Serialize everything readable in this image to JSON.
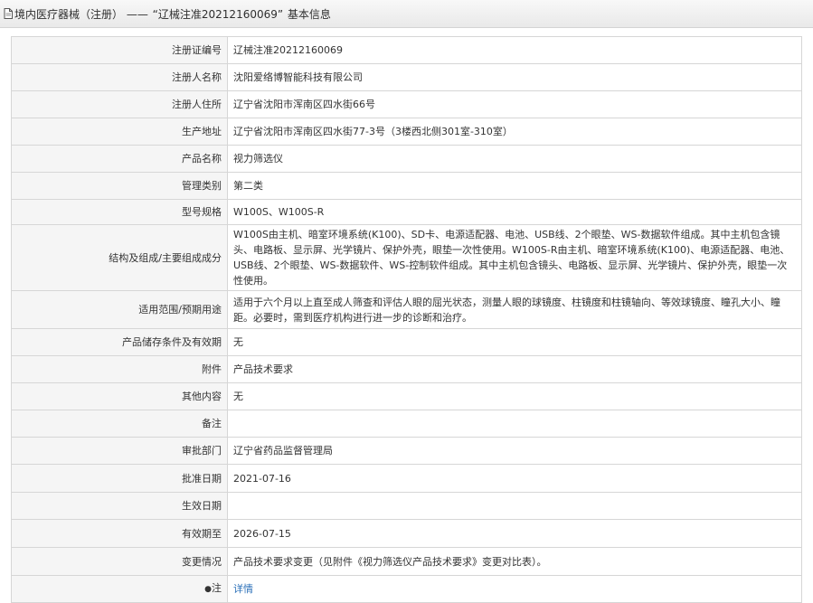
{
  "header": {
    "prefix": "境内医疗器械（注册）",
    "dash": "——",
    "reg_quote": "“辽械注准20212160069”",
    "suffix": "基本信息"
  },
  "rows": [
    {
      "label": "注册证编号",
      "value": "辽械注准20212160069"
    },
    {
      "label": "注册人名称",
      "value": "沈阳爱络博智能科技有限公司"
    },
    {
      "label": "注册人住所",
      "value": "辽宁省沈阳市浑南区四水街66号"
    },
    {
      "label": "生产地址",
      "value": "辽宁省沈阳市浑南区四水街77-3号（3楼西北侧301室-310室）"
    },
    {
      "label": "产品名称",
      "value": "视力筛选仪"
    },
    {
      "label": "管理类别",
      "value": "第二类"
    },
    {
      "label": "型号规格",
      "value": "W100S、W100S-R"
    },
    {
      "label": "结构及组成/主要组成成分",
      "value": "W100S由主机、暗室环境系统(K100)、SD卡、电源适配器、电池、USB线、2个眼垫、WS-数据软件组成。其中主机包含镜头、电路板、显示屏、光学镜片、保护外壳，眼垫一次性使用。W100S-R由主机、暗室环境系统(K100)、电源适配器、电池、USB线、2个眼垫、WS-数据软件、WS-控制软件组成。其中主机包含镜头、电路板、显示屏、光学镜片、保护外壳，眼垫一次性使用。"
    },
    {
      "label": "适用范围/预期用途",
      "value": "适用于六个月以上直至成人筛查和评估人眼的屈光状态，测量人眼的球镜度、柱镜度和柱镜轴向、等效球镜度、瞳孔大小、瞳距。必要时，需到医疗机构进行进一步的诊断和治疗。"
    },
    {
      "label": "产品储存条件及有效期",
      "value": "无"
    },
    {
      "label": "附件",
      "value": "产品技术要求"
    },
    {
      "label": "其他内容",
      "value": "无"
    },
    {
      "label": "备注",
      "value": ""
    },
    {
      "label": "审批部门",
      "value": "辽宁省药品监督管理局"
    },
    {
      "label": "批准日期",
      "value": "2021-07-16"
    },
    {
      "label": "生效日期",
      "value": ""
    },
    {
      "label": "有效期至",
      "value": "2026-07-15"
    },
    {
      "label": "变更情况",
      "value": "产品技术要求变更（见附件《视力筛选仪产品技术要求》变更对比表）。"
    },
    {
      "label_bullet": "●",
      "label": "注",
      "value": "详情"
    }
  ],
  "colors": {
    "link": "#2a6fb8",
    "label_bg": "#f5f5f5",
    "border": "#d6d6d6"
  },
  "icons": {
    "header": "document-icon",
    "note": "bullet-icon"
  }
}
